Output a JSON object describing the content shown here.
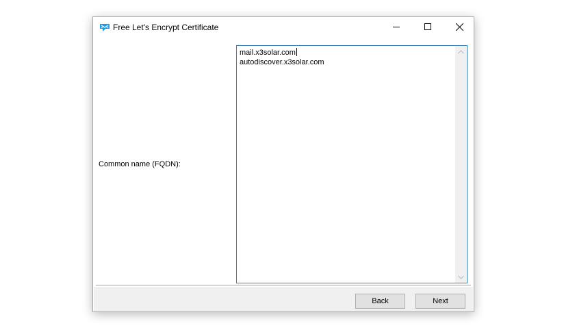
{
  "window": {
    "title": "Free Let's Encrypt Certificate",
    "icon": "app-cert-icon",
    "controls": {
      "minimize": "minimize-icon",
      "maximize": "maximize-icon",
      "close": "close-icon"
    }
  },
  "form": {
    "common_name_label": "Common name (FQDN):",
    "common_name_lines": [
      "mail.x3solar.com",
      "autodiscover.x3solar.com"
    ]
  },
  "buttons": {
    "back_label": "Back",
    "next_label": "Next"
  },
  "colors": {
    "focus_border": "#3c7fb1",
    "icon_accent": "#1e9be6",
    "bottom_bar": "#f0f0f0",
    "button_face": "#e1e1e1"
  }
}
